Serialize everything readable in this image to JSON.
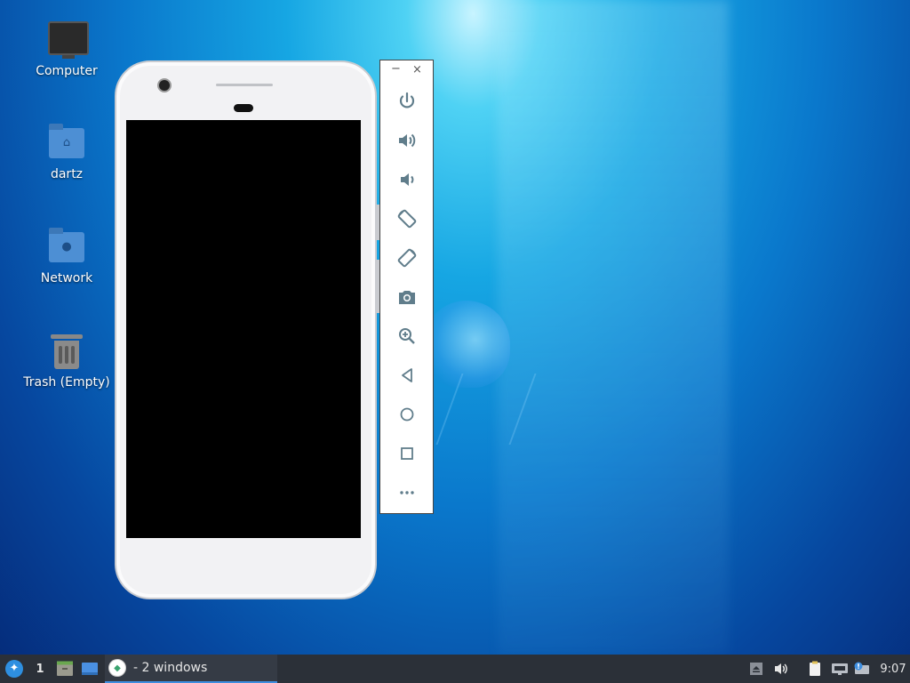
{
  "desktop": {
    "icons": [
      {
        "label": "Computer",
        "icon": "computer-icon"
      },
      {
        "label": "dartz",
        "icon": "home-folder-icon"
      },
      {
        "label": "Network",
        "icon": "network-folder-icon"
      },
      {
        "label": "Trash (Empty)",
        "icon": "trash-icon"
      }
    ]
  },
  "emulator_toolbar": {
    "window_controls": [
      "−",
      "×"
    ],
    "buttons": [
      {
        "icon": "power-icon"
      },
      {
        "icon": "volume-up-icon"
      },
      {
        "icon": "volume-down-icon"
      },
      {
        "icon": "rotate-left-icon"
      },
      {
        "icon": "rotate-right-icon"
      },
      {
        "icon": "camera-icon"
      },
      {
        "icon": "zoom-icon"
      },
      {
        "icon": "back-icon"
      },
      {
        "icon": "home-icon"
      },
      {
        "icon": "overview-icon"
      },
      {
        "icon": "more-icon"
      }
    ]
  },
  "taskbar": {
    "workspace": "1",
    "task_label": "- 2 windows",
    "clock": "9:07"
  },
  "colors": {
    "taskbar_bg": "#2b3038",
    "accent": "#3d8ee0",
    "icon_gray": "#607d8b"
  }
}
